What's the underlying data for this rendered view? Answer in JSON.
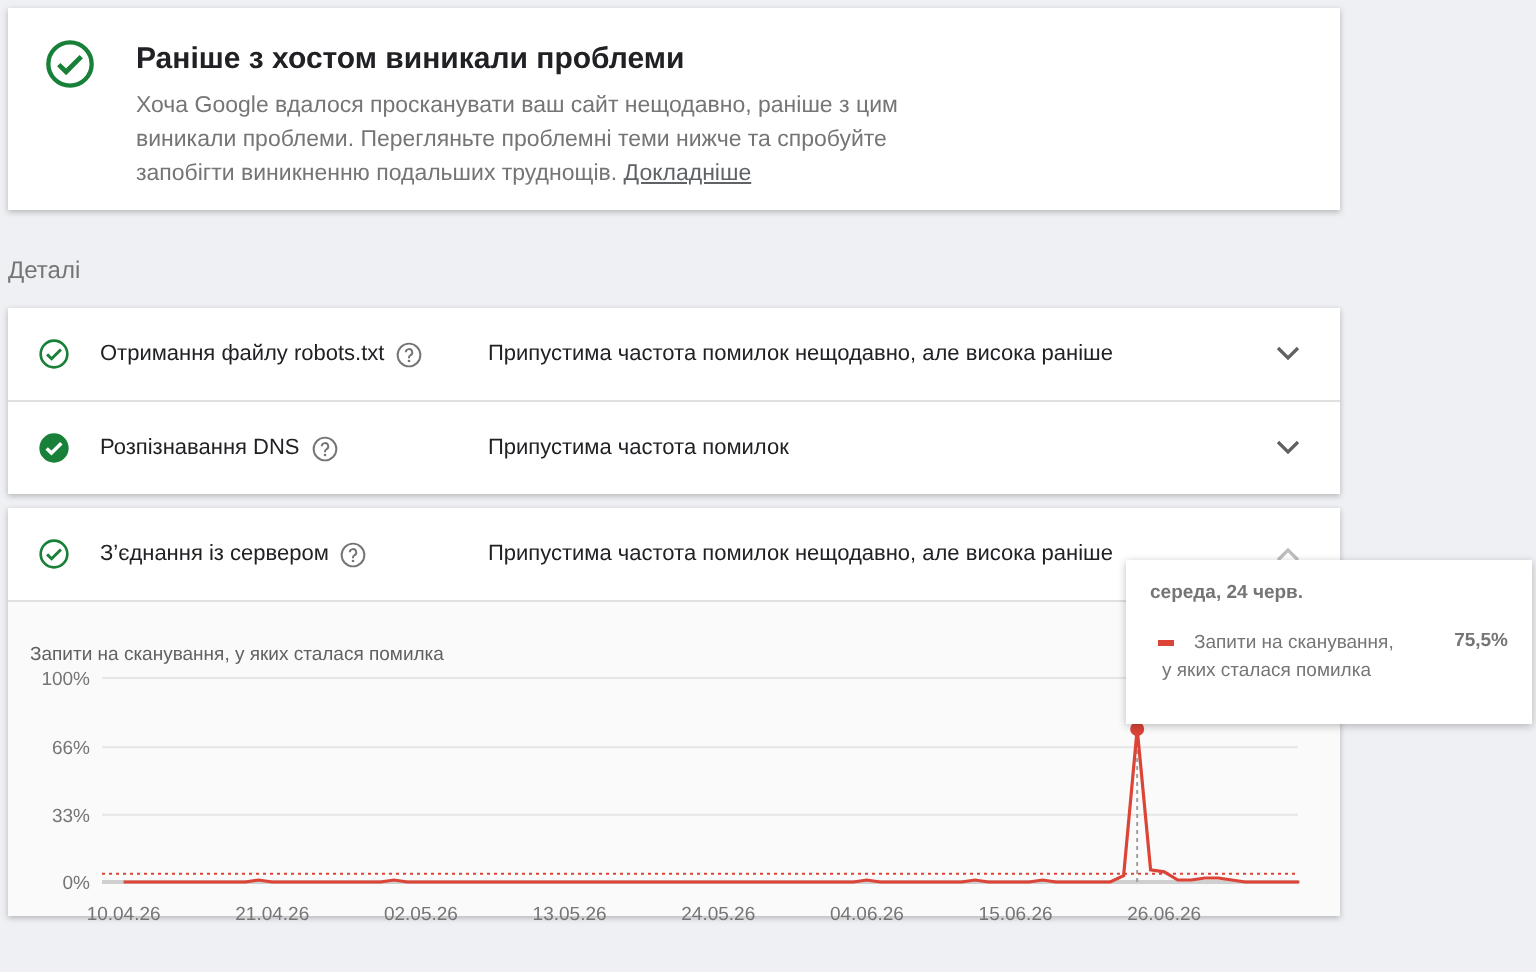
{
  "summary": {
    "title": "Раніше з хостом виникали проблеми",
    "description": "Хоча Google вдалося просканувати ваш сайт нещодавно, раніше з цим виникали проблеми. Перегляньте проблемні теми нижче та спробуйте запобігти виникненню подальших труднощів.",
    "link": "Докладніше"
  },
  "section_label": "Деталі",
  "groups": [
    {
      "rows": [
        {
          "label": "Отримання файлу robots.txt",
          "kind": "outline",
          "status": "Припустима частота помилок нещодавно, але висока раніше",
          "expanded": false
        },
        {
          "label": "Розпізнавання DNS",
          "kind": "filled",
          "status": "Припустима частота помилок",
          "expanded": false
        }
      ]
    },
    {
      "rows": [
        {
          "label": "З’єднання із сервером",
          "kind": "outline",
          "status": "Припустима частота помилок нещодавно, але висока раніше",
          "expanded": true,
          "chart_data": {
            "type": "line",
            "title": "Запити на сканування, у яких сталася помилка",
            "categories": [
              "10.04.26",
              null,
              null,
              null,
              null,
              null,
              null,
              null,
              null,
              null,
              null,
              "21.04.26",
              null,
              null,
              null,
              null,
              null,
              null,
              null,
              null,
              null,
              null,
              "02.05.26",
              null,
              null,
              null,
              null,
              null,
              null,
              null,
              null,
              null,
              null,
              "13.05.26",
              null,
              null,
              null,
              null,
              null,
              null,
              null,
              null,
              null,
              null,
              "24.05.26",
              null,
              null,
              null,
              null,
              null,
              null,
              null,
              null,
              null,
              null,
              "04.06.26",
              null,
              null,
              null,
              null,
              null,
              null,
              null,
              null,
              null,
              null,
              "15.06.26",
              null,
              null,
              null,
              null,
              null,
              null,
              null,
              null,
              null,
              null,
              "26.06.26",
              null,
              null,
              null,
              null,
              null,
              null,
              null,
              null,
              null,
              null
            ],
            "series": [
              {
                "name": "Запити на сканування, у яких сталася помилка",
                "color": "#db4437",
                "values": [
                  0,
                  0,
                  0,
                  0,
                  0,
                  0,
                  0,
                  0,
                  0,
                  0,
                  1,
                  0,
                  0,
                  0,
                  0,
                  0,
                  0,
                  0,
                  0,
                  0,
                  1,
                  0,
                  0,
                  0,
                  0,
                  0,
                  0,
                  0,
                  0,
                  0,
                  0,
                  0,
                  0,
                  0,
                  0,
                  0,
                  0,
                  0,
                  0,
                  0,
                  0,
                  0,
                  0,
                  0,
                  0,
                  0,
                  0,
                  0,
                  0,
                  0,
                  0,
                  0,
                  0,
                  0,
                  0,
                  1,
                  0,
                  0,
                  0,
                  0,
                  0,
                  0,
                  0,
                  1,
                  0,
                  0,
                  0,
                  0,
                  1,
                  0,
                  0,
                  0,
                  0,
                  0,
                  3,
                  75,
                  6,
                  5,
                  1,
                  1,
                  2,
                  2,
                  1,
                  0,
                  0,
                  0,
                  0,
                  0
                ]
              }
            ],
            "ylim": [
              0,
              100
            ],
            "yticks": [
              {
                "value": 0,
                "label": "0%"
              },
              {
                "value": 33,
                "label": "33%"
              },
              {
                "value": 66,
                "label": "66%"
              },
              {
                "value": 100,
                "label": "100%"
              }
            ],
            "ref_lines": [
              {
                "axis": "y",
                "value": 4
              }
            ]
          },
          "tooltip": {
            "date": "середа, 24 черв.",
            "value": "75,5%"
          }
        }
      ]
    }
  ]
}
